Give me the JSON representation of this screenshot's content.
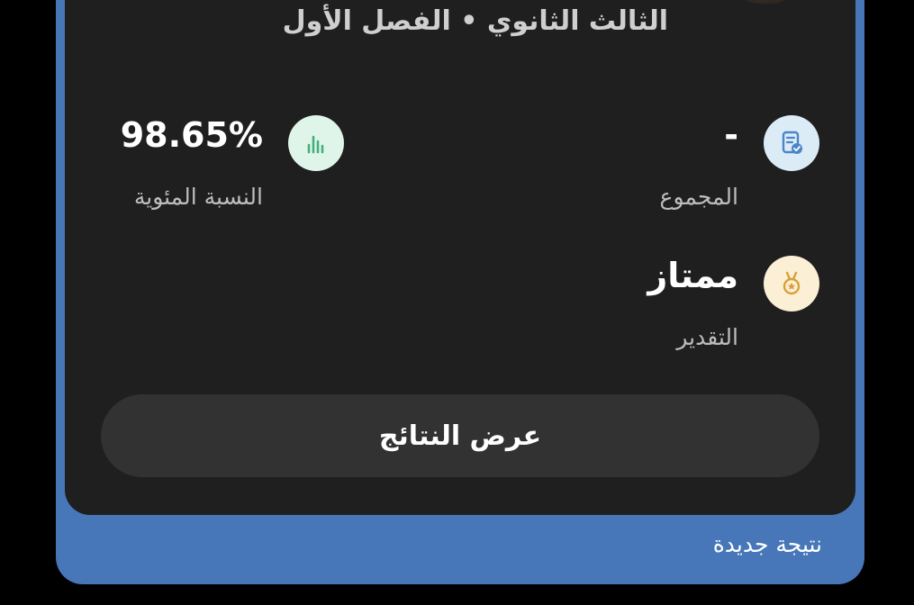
{
  "header": {
    "subtitle": "الثالث الثانوي • الفصل الأول"
  },
  "stats": {
    "total": {
      "value": "-",
      "label": "المجموع",
      "icon": "document-check-icon",
      "icon_bg": "#dcecf7"
    },
    "percentage": {
      "value": "98.65%",
      "label": "النسبة المئوية",
      "icon": "bar-chart-icon",
      "icon_bg": "#e0f5ea"
    },
    "grade": {
      "value": "ممتاز",
      "label": "التقدير",
      "icon": "medal-icon",
      "icon_bg": "#fbf0d5"
    }
  },
  "actions": {
    "view_results_label": "عرض النتائج"
  },
  "footer": {
    "new_result_label": "نتيجة جديدة"
  },
  "colors": {
    "outer_card": "#4777b8",
    "inner_card": "#1f1f1f",
    "button_bg": "#323232"
  }
}
